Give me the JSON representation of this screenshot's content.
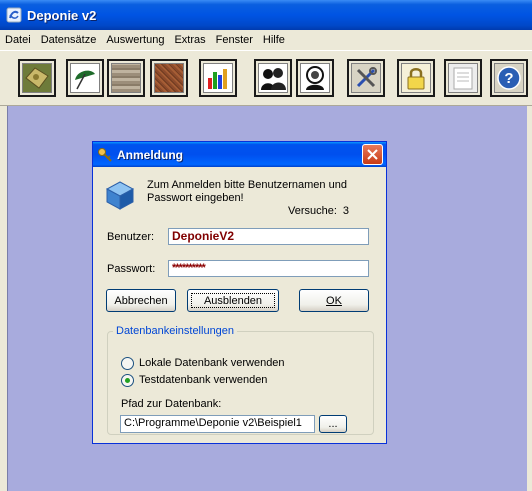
{
  "app": {
    "title": "Deponie v2"
  },
  "menu": [
    "Datei",
    "Datensätze",
    "Auswertung",
    "Extras",
    "Fenster",
    "Hilfe"
  ],
  "toolbar": [
    "map-icon",
    "umbrella-icon",
    "soil-sample-icon",
    "soil-layer-icon",
    "bar-chart-icon",
    "users-icon",
    "user-search-icon",
    "tools-icon",
    "lock-icon",
    "document-icon",
    "help-icon"
  ],
  "dialog": {
    "title": "Anmeldung",
    "instruction": "Zum Anmelden bitte Benutzernamen und Passwort eingeben!",
    "attempts_label": "Versuche:",
    "attempts_value": "3",
    "user_label": "Benutzer:",
    "user_value": "DeponieV2",
    "password_label": "Passwort:",
    "password_value": "**********",
    "buttons": {
      "cancel": "Abbrechen",
      "hide": "Ausblenden",
      "ok": "OK"
    },
    "db_group": {
      "title": "Datenbankeinstellungen",
      "local_option": "Lokale Datenbank verwenden",
      "test_option": "Testdatenbank verwenden",
      "selected": "test",
      "path_label": "Pfad zur Datenbank:",
      "path_value": "C:\\Programme\\Deponie v2\\Beispiel1",
      "browse": "..."
    }
  },
  "colors": {
    "titlebar": "#0054E3",
    "workspace": "#A8ABDD",
    "password_text": "#8B0000",
    "user_text": "#800000"
  }
}
